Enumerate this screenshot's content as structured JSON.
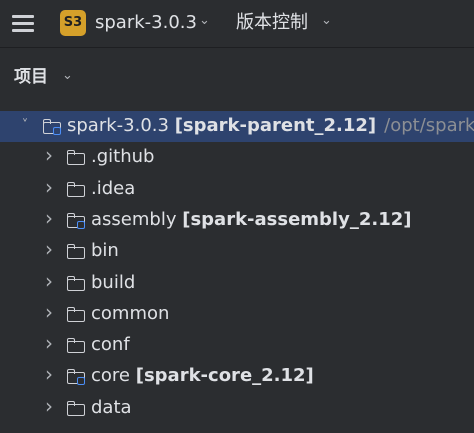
{
  "titlebar": {
    "project_badge": "S3",
    "project_name": "spark-3.0.3",
    "vcs_label": "版本控制"
  },
  "panel": {
    "title": "项目"
  },
  "tree": [
    {
      "name": "spark-3.0.3",
      "module": "[spark-parent_2.12]",
      "path": "/opt/spark",
      "level": 0,
      "expanded": true,
      "is_module": true,
      "selected": true
    },
    {
      "name": ".github",
      "module": "",
      "level": 1,
      "expanded": false,
      "is_module": false
    },
    {
      "name": ".idea",
      "module": "",
      "level": 1,
      "expanded": false,
      "is_module": false
    },
    {
      "name": "assembly",
      "module": "[spark-assembly_2.12]",
      "level": 1,
      "expanded": false,
      "is_module": true
    },
    {
      "name": "bin",
      "module": "",
      "level": 1,
      "expanded": false,
      "is_module": false
    },
    {
      "name": "build",
      "module": "",
      "level": 1,
      "expanded": false,
      "is_module": false
    },
    {
      "name": "common",
      "module": "",
      "level": 1,
      "expanded": false,
      "is_module": false
    },
    {
      "name": "conf",
      "module": "",
      "level": 1,
      "expanded": false,
      "is_module": false
    },
    {
      "name": "core",
      "module": "[spark-core_2.12]",
      "level": 1,
      "expanded": false,
      "is_module": true
    },
    {
      "name": "data",
      "module": "",
      "level": 1,
      "expanded": false,
      "is_module": false
    }
  ],
  "colors": {
    "background": "#2b2d30",
    "selection": "#2e436e",
    "badge": "#d5a02a",
    "module_marker": "#4b8ef7",
    "text": "#dfe1e5",
    "muted": "#8c8f94"
  }
}
